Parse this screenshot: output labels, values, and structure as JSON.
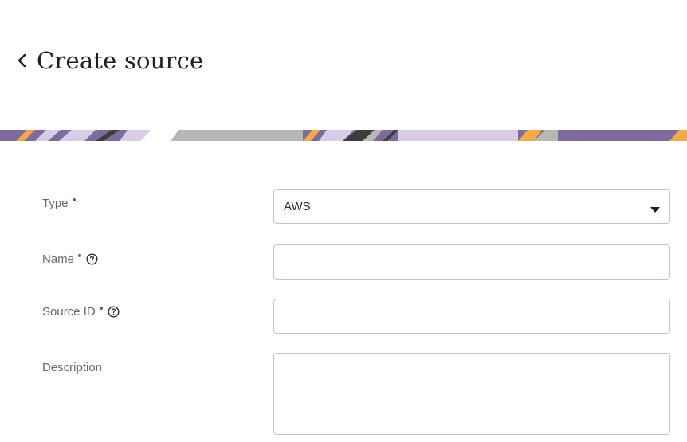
{
  "header": {
    "title": "Create source",
    "back_icon": "chevron-left-icon"
  },
  "banner": {
    "colors": [
      "#7d6b9e",
      "#f2a94a",
      "#d7cde6",
      "#b9b7b3",
      "#3f3d3a",
      "#ffffff"
    ]
  },
  "form": {
    "type": {
      "label": "Type",
      "required": true,
      "value": "AWS",
      "icon": "chevron-down-icon"
    },
    "name": {
      "label": "Name",
      "required": true,
      "help_icon": "help-icon",
      "value": ""
    },
    "source_id": {
      "label": "Source ID",
      "required": true,
      "help_icon": "help-icon",
      "value": ""
    },
    "description": {
      "label": "Description",
      "required": false,
      "value": ""
    }
  },
  "colors": {
    "required_dot": "#3d7a4e",
    "label_text": "#6b6762",
    "border": "#c7c3bd"
  }
}
